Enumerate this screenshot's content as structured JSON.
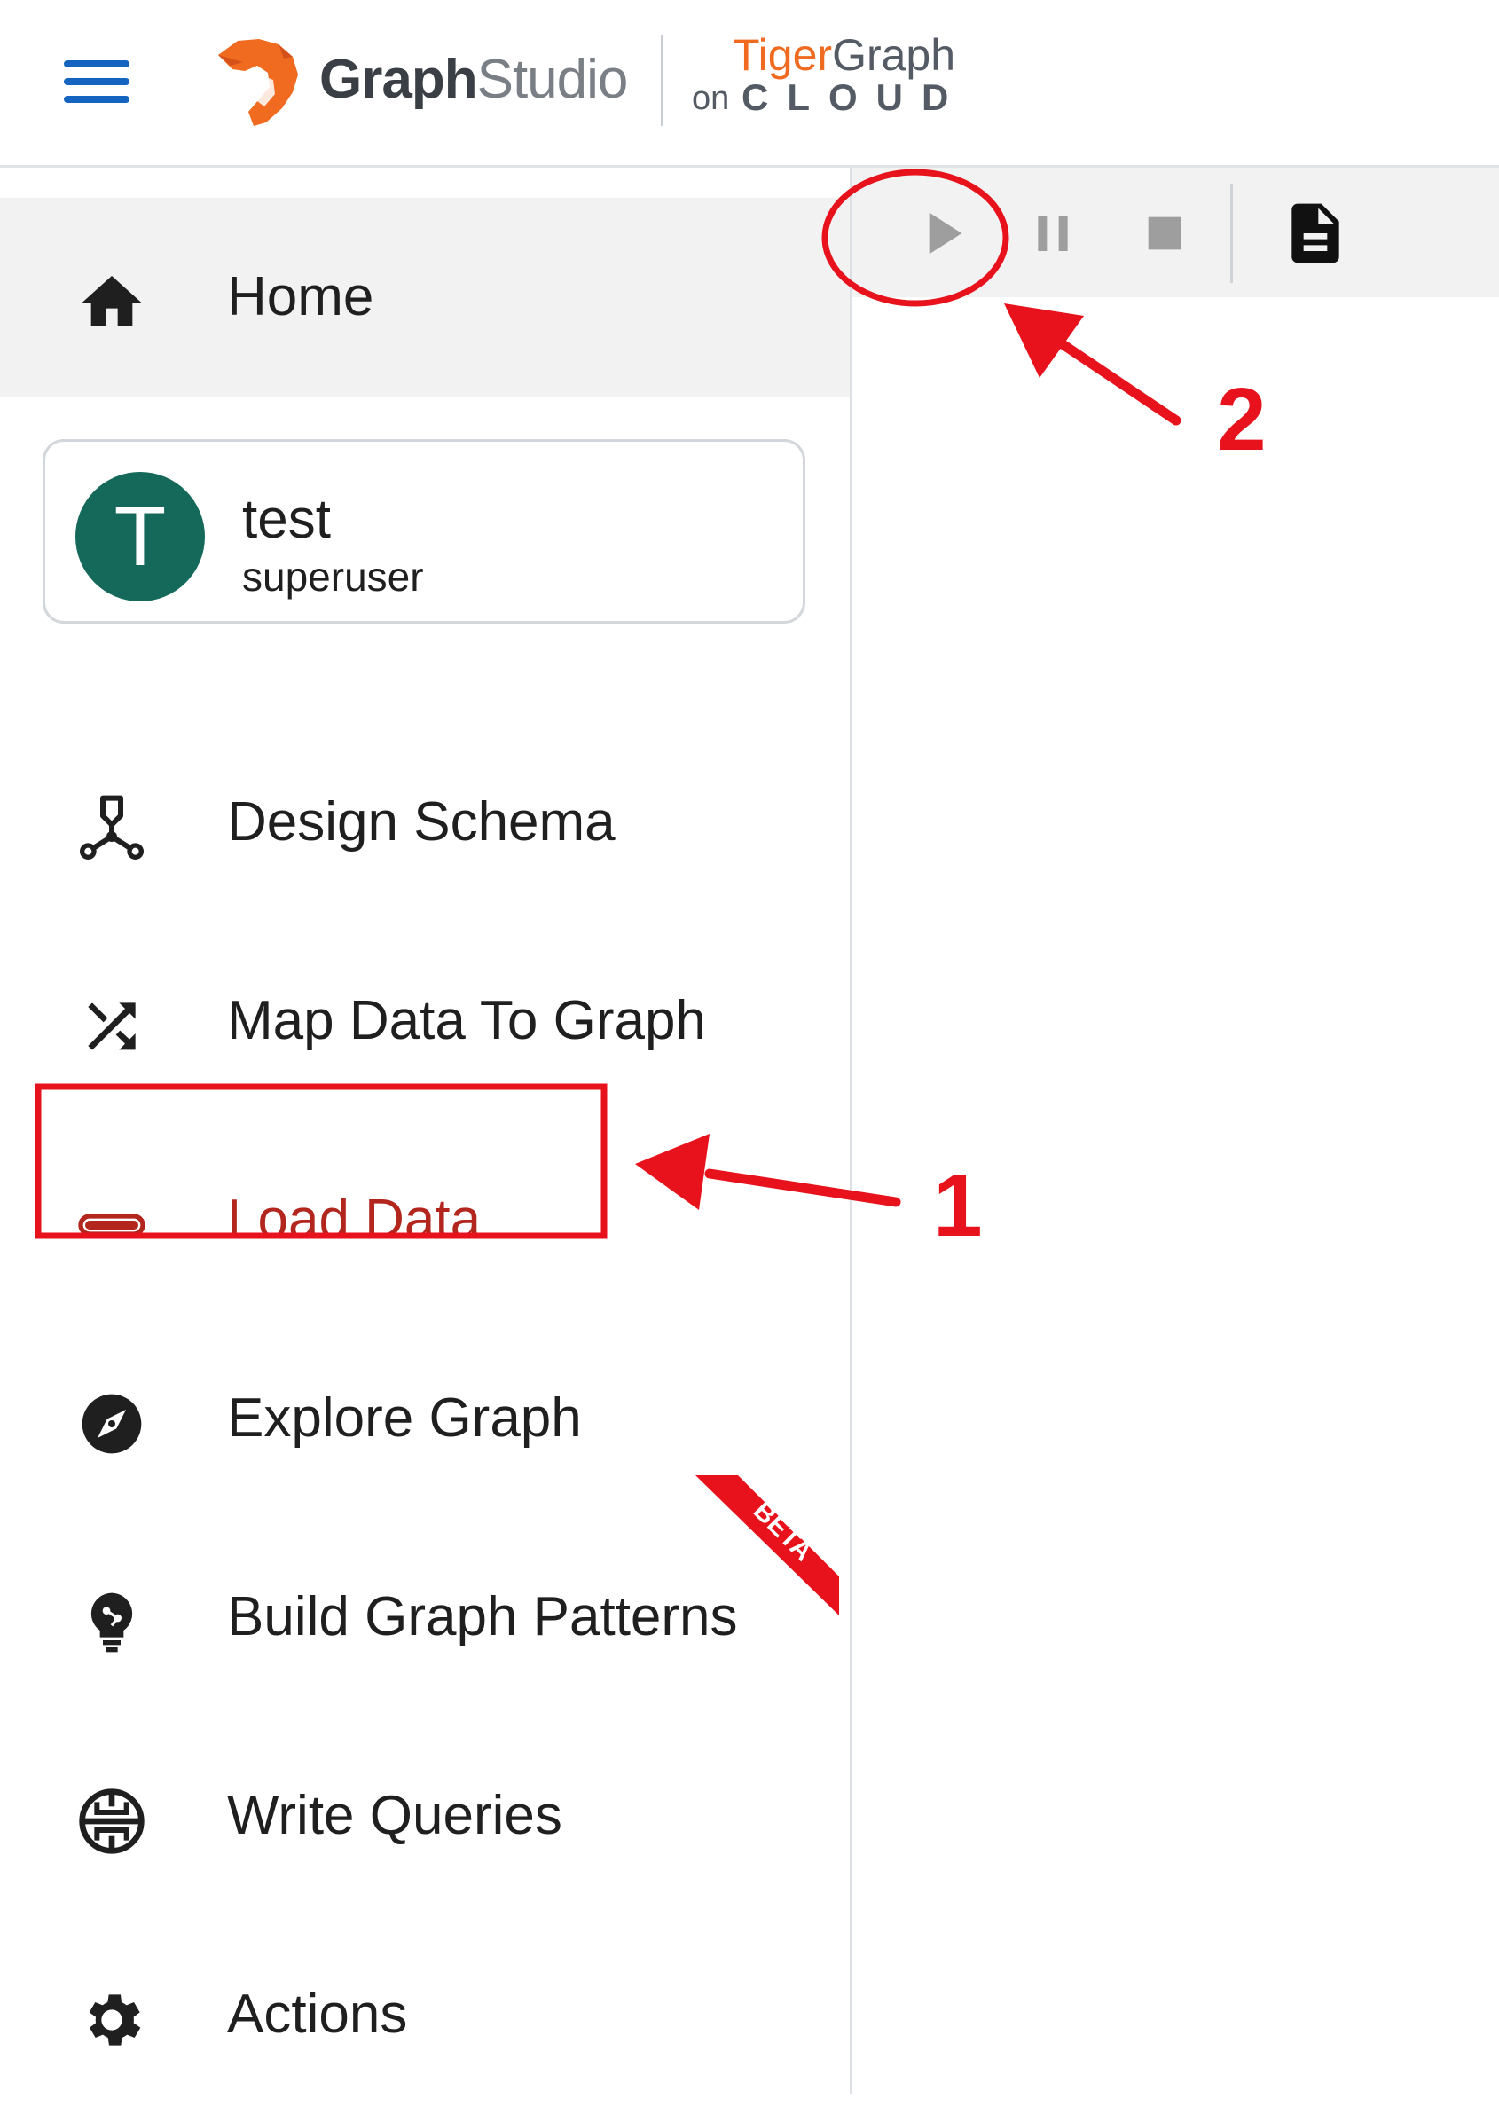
{
  "header": {
    "brand_primary": "Graph",
    "brand_secondary": "Studio",
    "partner_part1": "Tiger",
    "partner_part2": "Graph",
    "partner_on": "on",
    "partner_cloud": "CLOUD",
    "icons": {
      "menu": "hamburger-menu-icon",
      "logo": "tiger-logo"
    },
    "colors": {
      "menu": "#1565c0",
      "tiger_orange": "#f06b20",
      "text_dark": "#3a3f45"
    }
  },
  "sidebar": {
    "home": {
      "label": "Home",
      "icon": "home-icon"
    },
    "user": {
      "initial": "T",
      "name": "test",
      "role": "superuser",
      "avatar_color": "#14695a"
    },
    "items": [
      {
        "label": "Design Schema",
        "icon": "schema-icon"
      },
      {
        "label": "Map Data To Graph",
        "icon": "shuffle-icon"
      },
      {
        "label": "Load Data",
        "icon": "progress-bar-icon",
        "active": true
      },
      {
        "label": "Explore Graph",
        "icon": "compass-icon"
      },
      {
        "label": "Build Graph Patterns",
        "icon": "lightbulb-icon",
        "badge": "BETA"
      },
      {
        "label": "Write Queries",
        "icon": "gsql-icon"
      },
      {
        "label": "Actions",
        "icon": "gear-icon"
      }
    ],
    "active_color": "#b3261e"
  },
  "toolbar": {
    "buttons": [
      {
        "name": "start-loading-button",
        "icon": "play-icon"
      },
      {
        "name": "pause-loading-button",
        "icon": "pause-icon"
      },
      {
        "name": "stop-loading-button",
        "icon": "stop-icon"
      },
      {
        "name": "view-log-button",
        "icon": "document-icon"
      }
    ]
  },
  "annotations": {
    "step1": "1",
    "step2": "2",
    "color": "#e8121c"
  }
}
